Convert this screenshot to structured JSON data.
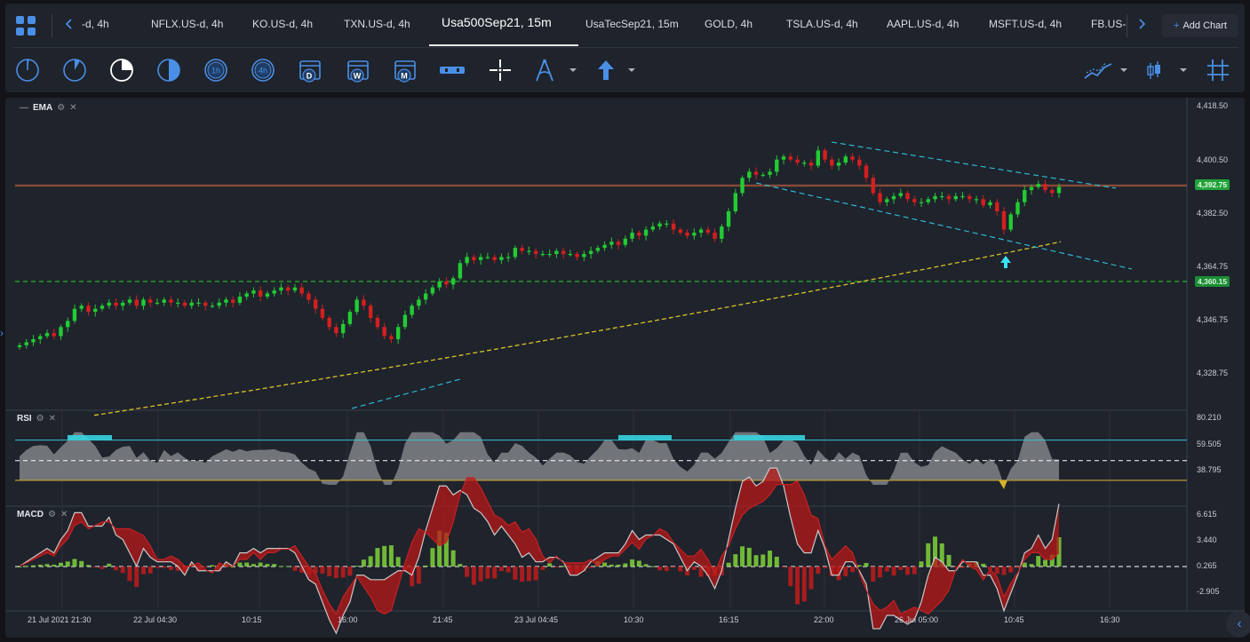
{
  "tabs": [
    {
      "label": "-d, 4h"
    },
    {
      "label": "NFLX.US-d, 4h"
    },
    {
      "label": "KO.US-d, 4h"
    },
    {
      "label": "TXN.US-d, 4h"
    },
    {
      "label": "Usa500Sep21, 15m",
      "active": true
    },
    {
      "label": "UsaTecSep21, 15m"
    },
    {
      "label": "GOLD, 4h"
    },
    {
      "label": "TSLA.US-d, 4h"
    },
    {
      "label": "AAPL.US-d, 4h"
    },
    {
      "label": "MSFT.US-d, 4h"
    },
    {
      "label": "FB.US-"
    }
  ],
  "add_chart": {
    "plus": "+",
    "label": "Add Chart"
  },
  "toolbar": {
    "icons": [
      "timeframe-1m-icon",
      "timeframe-5m-icon",
      "timeframe-15m-icon",
      "timeframe-30m-icon",
      "timeframe-1h-icon",
      "timeframe-4h-icon",
      "calendar-day-icon",
      "calendar-week-icon",
      "calendar-month-icon",
      "ruler-icon",
      "crosshair-icon",
      "drawing-tools-icon",
      "arrow-up-icon",
      "chart-type-icon",
      "indicator-icon",
      "grid-icon"
    ],
    "tf_1h": "1h",
    "tf_4h": "4h",
    "cal_d": "D",
    "cal_w": "W",
    "cal_m": "M"
  },
  "panes": {
    "main": {
      "label": "EMA",
      "minus": "—",
      "settings": "⚙",
      "close": "✕"
    },
    "rsi": {
      "label": "RSI",
      "settings": "⚙",
      "close": "✕"
    },
    "macd": {
      "label": "MACD",
      "settings": "⚙",
      "close": "✕"
    }
  },
  "price_axis": [
    "4,418.50",
    "4,400.50",
    "4,382.50",
    "4,364.75",
    "4,346.75",
    "4,328.75"
  ],
  "price_tags": {
    "current": "4,392.75",
    "level": "4,360.15"
  },
  "rsi_axis": [
    "80.210",
    "59.505",
    "38.795"
  ],
  "macd_axis": [
    "6.615",
    "3.440",
    "0.265",
    "-2.905"
  ],
  "time_axis": [
    "21 Jul 2021 21:30",
    "22 Jul 04:30",
    "10:15",
    "16:00",
    "21:45",
    "23 Jul 04:45",
    "10:30",
    "16:15",
    "22:00",
    "26 Jul 05:00",
    "10:45",
    "16:30"
  ],
  "colors": {
    "accent": "#4a8fe6",
    "bull": "#22cc33",
    "bear": "#d41f1f",
    "ema": "#d6c22a",
    "trend": "#2ec5e0",
    "level": "#2bd629",
    "resistance": "#a0543a"
  },
  "chart_data": {
    "type": "candlestick",
    "symbol": "Usa500Sep21",
    "timeframe": "15m",
    "ylim": [
      4322,
      4420
    ],
    "close_series": [
      4341,
      4342,
      4343,
      4344,
      4345,
      4344,
      4347,
      4349,
      4353,
      4354,
      4352,
      4353,
      4354,
      4355,
      4354,
      4355,
      4356,
      4354,
      4356,
      4355,
      4355,
      4356,
      4355,
      4355,
      4354,
      4355,
      4355,
      4354,
      4354,
      4355,
      4356,
      4355,
      4357,
      4358,
      4359,
      4357,
      4358,
      4359,
      4360,
      4359,
      4360,
      4358,
      4356,
      4353,
      4350,
      4347,
      4345,
      4348,
      4352,
      4356,
      4354,
      4350,
      4347,
      4344,
      4343,
      4347,
      4351,
      4354,
      4356,
      4358,
      4360,
      4362,
      4361,
      4363,
      4368,
      4370,
      4369,
      4370,
      4370,
      4369,
      4370,
      4370,
      4373,
      4372,
      4372,
      4371,
      4371,
      4371,
      4372,
      4371,
      4371,
      4370,
      4371,
      4372,
      4373,
      4374,
      4375,
      4374,
      4376,
      4378,
      4377,
      4379,
      4380,
      4381,
      4381,
      4379,
      4378,
      4377,
      4378,
      4379,
      4378,
      4376,
      4380,
      4385,
      4391,
      4396,
      4398,
      4397,
      4397,
      4398,
      4402,
      4403,
      4402,
      4401,
      4401,
      4400,
      4405,
      4402,
      4400,
      4401,
      4403,
      4402,
      4400,
      4396,
      4391,
      4388,
      4389,
      4390,
      4391,
      4389,
      4388,
      4388,
      4389,
      4390,
      4390,
      4389,
      4390,
      4390,
      4389,
      4389,
      4387,
      4388,
      4385,
      4379,
      4384,
      4388,
      4392,
      4393,
      4394,
      4392,
      4391,
      4393
    ]
  }
}
